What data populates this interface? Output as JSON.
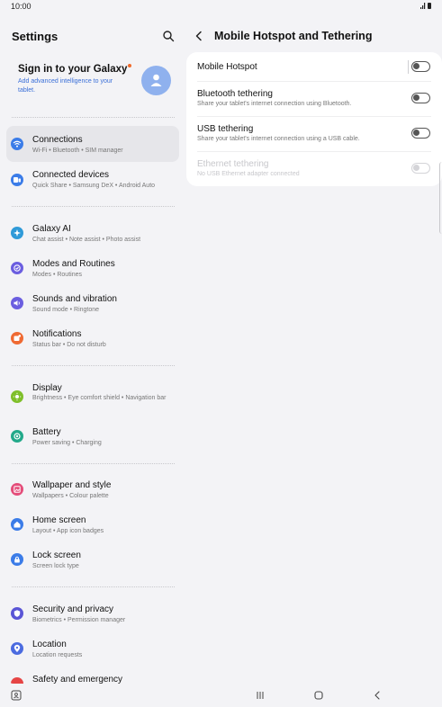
{
  "status_bar": {
    "time": "10:00"
  },
  "sidebar": {
    "title": "Settings",
    "account": {
      "title": "Sign in to your Galaxy",
      "subtitle": "Add advanced intelligence to your tablet."
    },
    "items": [
      {
        "label": "Connections",
        "sub": "Wi-Fi  •  Bluetooth  •  SIM manager",
        "icon": "wifi-icon",
        "color": "#3b7ce8"
      },
      {
        "label": "Connected devices",
        "sub": "Quick Share  •  Samsung DeX  •  Android Auto",
        "icon": "connected-devices-icon",
        "color": "#3b7ce8"
      },
      {
        "label": "Galaxy AI",
        "sub": "Chat assist  •  Note assist  •  Photo assist",
        "icon": "galaxy-ai-icon",
        "color": "#2f9ad8"
      },
      {
        "label": "Modes and Routines",
        "sub": "Modes  •  Routines",
        "icon": "modes-icon",
        "color": "#6b5ee0"
      },
      {
        "label": "Sounds and vibration",
        "sub": "Sound mode  •  Ringtone",
        "icon": "sound-icon",
        "color": "#6b5ee0"
      },
      {
        "label": "Notifications",
        "sub": "Status bar  •  Do not disturb",
        "icon": "notifications-icon",
        "color": "#ef6a33"
      },
      {
        "label": "Display",
        "sub": "Brightness  •  Eye comfort shield  •  Navigation bar",
        "icon": "display-icon",
        "color": "#7fbf2a"
      },
      {
        "label": "Battery",
        "sub": "Power saving  •  Charging",
        "icon": "battery-icon",
        "color": "#23a98a"
      },
      {
        "label": "Wallpaper and style",
        "sub": "Wallpapers  •  Colour palette",
        "icon": "wallpaper-icon",
        "color": "#e44d7a"
      },
      {
        "label": "Home screen",
        "sub": "Layout  •  App icon badges",
        "icon": "home-icon",
        "color": "#3b7ce8"
      },
      {
        "label": "Lock screen",
        "sub": "Screen lock type",
        "icon": "lock-icon",
        "color": "#3b7ce8"
      },
      {
        "label": "Security and privacy",
        "sub": "Biometrics  •  Permission manager",
        "icon": "shield-icon",
        "color": "#5a55d6"
      },
      {
        "label": "Location",
        "sub": "Location requests",
        "icon": "location-icon",
        "color": "#4b6be0"
      },
      {
        "label": "Safety and emergency",
        "sub": "",
        "icon": "safety-icon",
        "color": "#e64545"
      }
    ]
  },
  "main": {
    "title": "Mobile Hotspot and Tethering",
    "rows": [
      {
        "label": "Mobile Hotspot",
        "sub": "",
        "enabled": true,
        "state": "off"
      },
      {
        "label": "Bluetooth tethering",
        "sub": "Share your tablet's internet connection using Bluetooth.",
        "enabled": true,
        "state": "off"
      },
      {
        "label": "USB tethering",
        "sub": "Share your tablet's internet connection using a USB cable.",
        "enabled": true,
        "state": "off"
      },
      {
        "label": "Ethernet tethering",
        "sub": "No USB Ethernet adapter connected",
        "enabled": false,
        "state": "off"
      }
    ]
  },
  "colors": {
    "accent": "#3b7ce8",
    "background": "#f3f3f6",
    "card": "#ffffff",
    "account_link": "#3a6fd8"
  }
}
